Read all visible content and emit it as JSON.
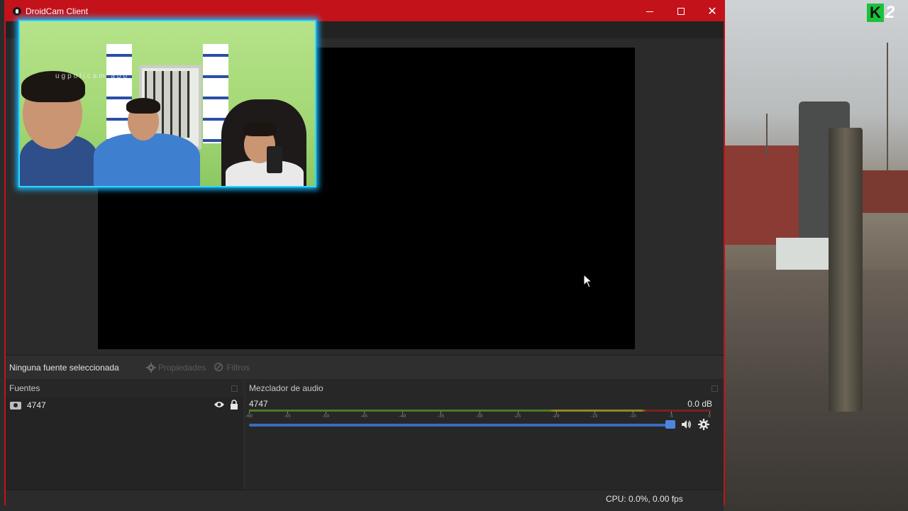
{
  "window": {
    "title": "DroidCam Client",
    "controls": {
      "minimize": "—",
      "maximize": "maximize",
      "close": "✕"
    }
  },
  "game_overlay": {
    "logo_letter": "K",
    "logo_number": "2"
  },
  "camera_overlay": {
    "watermark": "ugpolicam app"
  },
  "source_toolbar": {
    "no_source_label": "Ninguna fuente seleccionada",
    "properties_label": "Propiedades",
    "filters_label": "Filtros"
  },
  "sources_dock": {
    "title": "Fuentes",
    "items": [
      {
        "name": "4747",
        "icon": "camera-icon",
        "visible": true,
        "locked": true
      }
    ]
  },
  "mixer_dock": {
    "title": "Mezclador de audio",
    "channel": {
      "name": "4747",
      "level": "0.0 dB",
      "volume_fraction": 0.99
    },
    "scale": [
      "-60",
      "-55",
      "-50",
      "-45",
      "-40",
      "-35",
      "-30",
      "-25",
      "-20",
      "-15",
      "-10",
      "-5",
      "0"
    ]
  },
  "status": {
    "cpu": "CPU: 0.0%, 0.00 fps"
  },
  "colors": {
    "titlebar": "#c4121b",
    "accent": "#3c6bbd",
    "overlay_glow": "#2fd6ff"
  }
}
